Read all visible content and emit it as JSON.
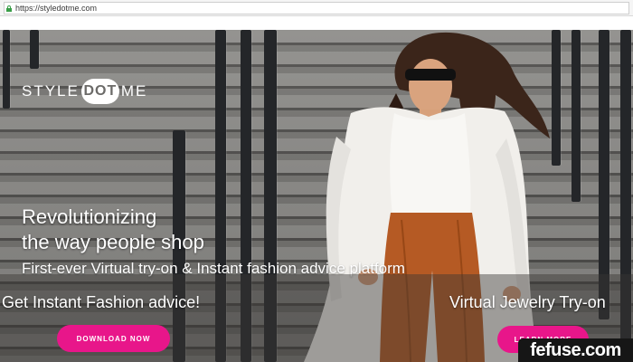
{
  "browser": {
    "url": "https://styledotme.com",
    "lock_icon": "lock-icon"
  },
  "hero": {
    "logo": {
      "left": "STYLE",
      "dot": "DOT",
      "right": "ME"
    },
    "headline_line1": "Revolutionizing",
    "headline_line2": "the way people shop",
    "tagline": "First-ever Virtual try-on & Instant fashion advice platform",
    "band": {
      "left_text": "Get Instant Fashion advice!",
      "right_text": "Virtual Jewelry Try-on",
      "download_label": "DOWNLOAD NOW",
      "learn_label": "LEARN MORE"
    }
  },
  "watermark": "fefuse.com",
  "colors": {
    "accent": "#e8168a",
    "overlay": "#3a3836",
    "lock_green": "#3a9e48"
  }
}
